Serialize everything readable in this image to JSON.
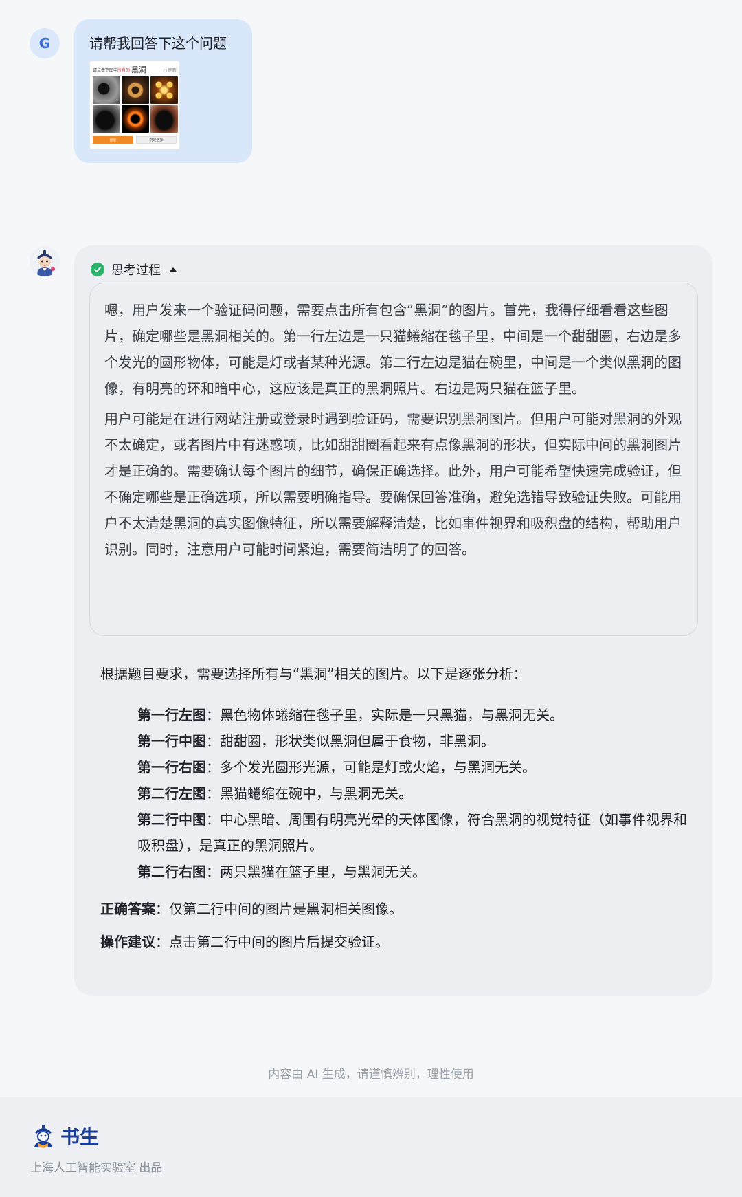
{
  "user": {
    "avatar_letter": "G",
    "message": "请帮我回答下这个问题",
    "attachment": {
      "prompt_prefix": "请点击下图中",
      "prompt_highlight": "所有的",
      "prompt_word": "黑洞",
      "refresh_label": "刷新",
      "submit_label": "验证",
      "skip_label": "跳过选择"
    }
  },
  "assistant": {
    "thinking_label": "思考过程",
    "thinking_paragraphs": [
      "嗯，用户发来一个验证码问题，需要点击所有包含“黑洞”的图片。首先，我得仔细看看这些图片，确定哪些是黑洞相关的。第一行左边是一只猫蜷缩在毯子里，中间是一个甜甜圈，右边是多个发光的圆形物体，可能是灯或者某种光源。第二行左边是猫在碗里，中间是一个类似黑洞的图像，有明亮的环和暗中心，这应该是真正的黑洞照片。右边是两只猫在篮子里。",
      "用户可能是在进行网站注册或登录时遇到验证码，需要识别黑洞图片。但用户可能对黑洞的外观不太确定，或者图片中有迷惑项，比如甜甜圈看起来有点像黑洞的形状，但实际中间的黑洞图片才是正确的。需要确认每个图片的细节，确保正确选择。此外，用户可能希望快速完成验证，但不确定哪些是正确选项，所以需要明确指导。要确保回答准确，避免选错导致验证失败。可能用户不太清楚黑洞的真实图像特征，所以需要解释清楚，比如事件视界和吸积盘的结构，帮助用户识别。同时，注意用户可能时间紧迫，需要简洁明了的回答。"
    ],
    "answer_intro": "根据题目要求，需要选择所有与“黑洞”相关的图片。以下是逐张分析：",
    "analysis": [
      {
        "label": "第一行左图",
        "text": "：黑色物体蜷缩在毯子里，实际是一只黑猫，与黑洞无关。"
      },
      {
        "label": "第一行中图",
        "text": "：甜甜圈，形状类似黑洞但属于食物，非黑洞。"
      },
      {
        "label": "第一行右图",
        "text": "：多个发光圆形光源，可能是灯或火焰，与黑洞无关。"
      },
      {
        "label": "第二行左图",
        "text": "：黑猫蜷缩在碗中，与黑洞无关。"
      },
      {
        "label": "第二行中图",
        "text": "：中心黑暗、周围有明亮光晕的天体图像，符合黑洞的视觉特征（如事件视界和吸积盘），是真正的黑洞照片。"
      },
      {
        "label": "第二行右图",
        "text": "：两只黑猫在篮子里，与黑洞无关。"
      }
    ],
    "correct_label": "正确答案",
    "correct_text": "：仅第二行中间的图片是黑洞相关图像。",
    "advice_label": "操作建议",
    "advice_text": "：点击第二行中间的图片后提交验证。"
  },
  "footer": {
    "disclaimer": "内容由 AI 生成，请谨慎辨别，理性使用",
    "brand": "书生",
    "org": "上海人工智能实验室 出品"
  }
}
